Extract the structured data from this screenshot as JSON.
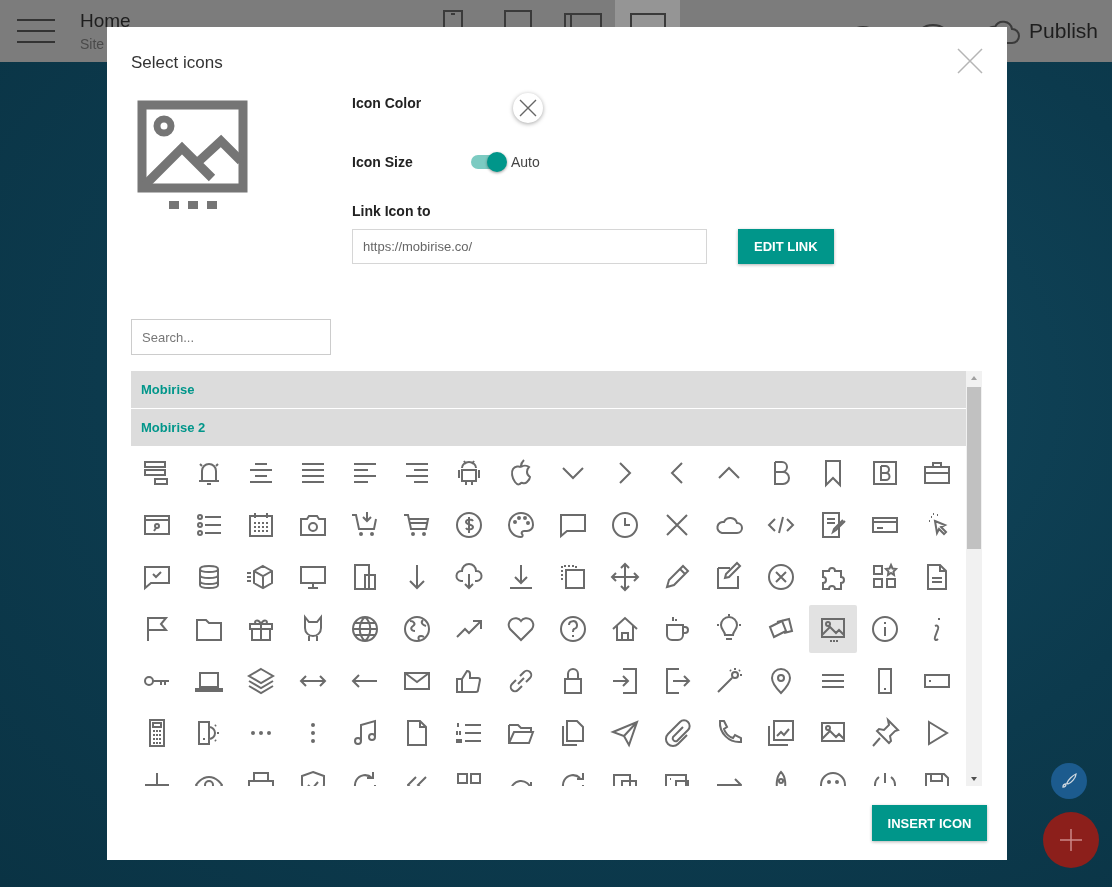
{
  "top_bar": {
    "page_title": "Home",
    "site_label": "Site",
    "devices": [
      {
        "selected": false
      },
      {
        "selected": false
      },
      {
        "selected": false
      },
      {
        "selected": true
      }
    ],
    "publish_label": "Publish"
  },
  "dialog": {
    "title": "Select icons",
    "icon_color": {
      "label": "Icon Color"
    },
    "icon_size": {
      "label": "Icon Size",
      "on": true,
      "text": "Auto"
    },
    "link": {
      "label": "Link Icon to",
      "value": "https://mobirise.co/",
      "button": "EDIT LINK"
    },
    "search": {
      "placeholder": "Search..."
    },
    "groups": [
      {
        "name": "Mobirise"
      },
      {
        "name": "Mobirise 2",
        "icons": [
          {
            "selected": false
          },
          {
            "selected": false
          },
          {
            "selected": false
          },
          {
            "selected": false
          },
          {
            "selected": false
          },
          {
            "selected": false
          },
          {
            "selected": false
          },
          {
            "selected": false
          },
          {
            "selected": false
          },
          {
            "selected": false
          },
          {
            "selected": false
          },
          {
            "selected": false
          },
          {
            "selected": false
          },
          {
            "selected": false
          },
          {
            "selected": false
          },
          {
            "selected": false
          },
          {
            "selected": false
          },
          {
            "selected": false
          },
          {
            "selected": false
          },
          {
            "selected": false
          },
          {
            "selected": false
          },
          {
            "selected": false
          },
          {
            "selected": false
          },
          {
            "selected": false
          },
          {
            "selected": false
          },
          {
            "selected": false
          },
          {
            "selected": false
          },
          {
            "selected": false
          },
          {
            "selected": false
          },
          {
            "selected": false
          },
          {
            "selected": false
          },
          {
            "selected": false
          },
          {
            "selected": false
          },
          {
            "selected": false
          },
          {
            "selected": false
          },
          {
            "selected": false
          },
          {
            "selected": false
          },
          {
            "selected": false
          },
          {
            "selected": false
          },
          {
            "selected": false
          },
          {
            "selected": false
          },
          {
            "selected": false
          },
          {
            "selected": false
          },
          {
            "selected": false
          },
          {
            "selected": false
          },
          {
            "selected": false
          },
          {
            "selected": false
          },
          {
            "selected": false
          },
          {
            "selected": false
          },
          {
            "selected": false
          },
          {
            "selected": false
          },
          {
            "selected": false
          },
          {
            "selected": false
          },
          {
            "selected": false
          },
          {
            "selected": false
          },
          {
            "selected": false
          },
          {
            "selected": false
          },
          {
            "selected": false
          },
          {
            "selected": false
          },
          {
            "selected": false
          },
          {
            "selected": false
          },
          {
            "selected": true
          },
          {
            "selected": false
          },
          {
            "selected": false
          },
          {
            "selected": false
          },
          {
            "selected": false
          },
          {
            "selected": false
          },
          {
            "selected": false
          },
          {
            "selected": false
          },
          {
            "selected": false
          },
          {
            "selected": false
          },
          {
            "selected": false
          },
          {
            "selected": false
          },
          {
            "selected": false
          },
          {
            "selected": false
          },
          {
            "selected": false
          },
          {
            "selected": false
          },
          {
            "selected": false
          },
          {
            "selected": false
          },
          {
            "selected": false
          },
          {
            "selected": false
          },
          {
            "selected": false
          },
          {
            "selected": false
          },
          {
            "selected": false
          },
          {
            "selected": false
          },
          {
            "selected": false
          },
          {
            "selected": false
          },
          {
            "selected": false
          },
          {
            "selected": false
          },
          {
            "selected": false
          },
          {
            "selected": false
          },
          {
            "selected": false
          },
          {
            "selected": false
          },
          {
            "selected": false
          },
          {
            "selected": false
          },
          {
            "selected": false
          },
          {
            "selected": false
          },
          {
            "selected": false
          },
          {
            "selected": false
          },
          {
            "selected": false
          },
          {
            "selected": false
          },
          {
            "selected": false
          },
          {
            "selected": false
          },
          {
            "selected": false
          },
          {
            "selected": false
          },
          {
            "selected": false
          },
          {
            "selected": false
          },
          {
            "selected": false
          },
          {
            "selected": false
          },
          {
            "selected": false
          },
          {
            "selected": false
          },
          {
            "selected": false
          }
        ]
      }
    ],
    "insert_button": "INSERT ICON"
  }
}
